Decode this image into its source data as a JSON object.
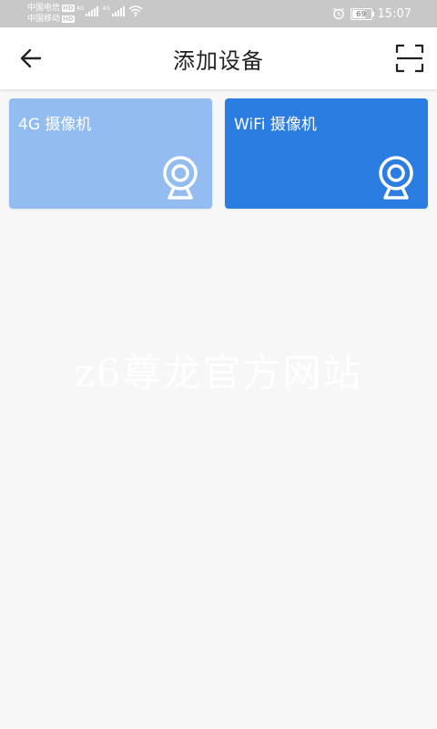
{
  "status_bar": {
    "carrier1": "中国电信",
    "carrier2": "中国移动",
    "hd_badge": "HD",
    "network_type": "4G",
    "battery": "69",
    "battery_level": 0.69,
    "time": "15:07",
    "icons": [
      "signal-icon",
      "wifi-icon",
      "alarm-icon",
      "battery-icon"
    ]
  },
  "header": {
    "title": "添加设备",
    "back_icon": "arrow-left-icon",
    "scan_icon": "scan-icon"
  },
  "devices": [
    {
      "label": "4G 摄像机",
      "color": "#93bcf0",
      "icon": "webcam-icon"
    },
    {
      "label": "WiFi 摄像机",
      "color": "#2b7de1",
      "icon": "webcam-icon"
    }
  ],
  "watermark": "z6尊龙官方网站",
  "colors": {
    "status_bar_bg": "#c8c8c8",
    "page_bg": "#f7f7f7",
    "header_bg": "#ffffff"
  }
}
